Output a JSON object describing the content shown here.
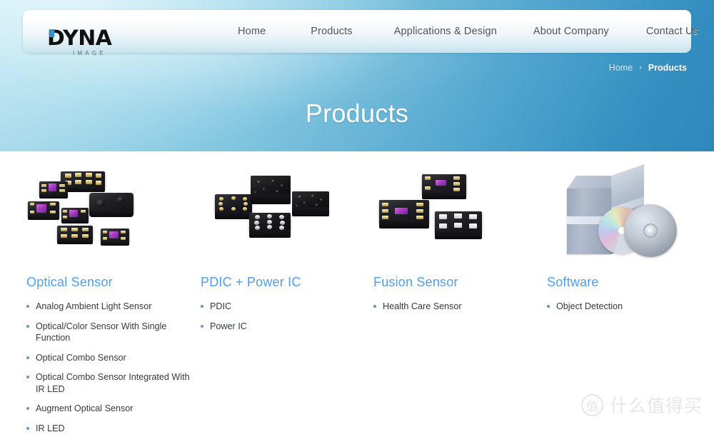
{
  "site": {
    "logo_main": "DYNA",
    "logo_sub": "IMAGE"
  },
  "nav": {
    "items": [
      {
        "label": "Home"
      },
      {
        "label": "Products"
      },
      {
        "label": "Applications & Design"
      },
      {
        "label": "About Company"
      },
      {
        "label": "Contact Us"
      }
    ]
  },
  "breadcrumb": {
    "home": "Home",
    "separator": "›",
    "current": "Products"
  },
  "page": {
    "title": "Products"
  },
  "colors": {
    "heading_blue": "#4c9ef4",
    "banner_light": "#b9e2ef",
    "banner_dark": "#2f88bb",
    "bullet": "#6e94b8",
    "body_text": "#333a3f",
    "nav_text": "#4c5358"
  },
  "products": [
    {
      "heading": "Optical Sensor",
      "image_name": "optical-sensor-photo",
      "items": [
        "Analog Ambient Light Sensor",
        "Optical/Color Sensor With Single Function",
        "Optical Combo Sensor",
        "Optical Combo Sensor Integrated With IR LED",
        "Augment Optical Sensor",
        "IR LED"
      ]
    },
    {
      "heading": "PDIC + Power IC",
      "image_name": "pdic-power-ic-photo",
      "items": [
        "PDIC",
        "Power IC"
      ]
    },
    {
      "heading": "Fusion Sensor",
      "image_name": "fusion-sensor-photo",
      "items": [
        "Health Care Sensor"
      ]
    },
    {
      "heading": "Software",
      "image_name": "software-box-cd-icon",
      "items": [
        "Object Detection"
      ]
    }
  ],
  "watermark": {
    "badge": "值",
    "text": "什么值得买"
  }
}
